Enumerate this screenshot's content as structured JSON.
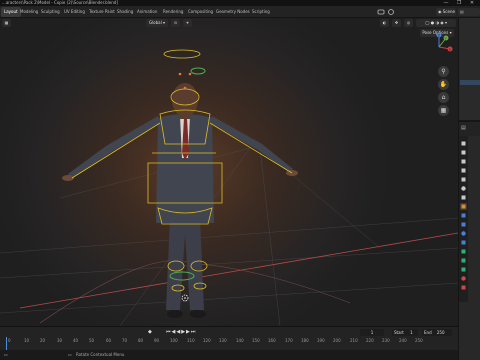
{
  "window": {
    "title": "...aracters\\Pack 2\\Model - Copie (2)\\Source\\Blender.blend]",
    "buttons": [
      "—",
      "❐",
      "✕"
    ]
  },
  "menubar": {
    "workspaces": [
      "Layout",
      "Modeling",
      "Sculpting",
      "UV Editing",
      "Texture Paint",
      "Shading",
      "Animation",
      "Rendering",
      "Compositing",
      "Geometry Nodes",
      "Scripting"
    ],
    "active_workspace": "Layout",
    "scene_label": "Scene"
  },
  "viewport": {
    "mode_label": "Global",
    "pose_options": "Pose Options",
    "axis_x": "X",
    "axis_y": "Y",
    "axis_z": "Z",
    "colors": {
      "bones": "#e0c020",
      "accent_ring": "#4caf50",
      "floor_line": "#b84a4a"
    }
  },
  "timeline": {
    "ruler_ticks": [
      "0",
      "10",
      "20",
      "30",
      "40",
      "50",
      "60",
      "70",
      "80",
      "90",
      "100",
      "110",
      "120",
      "130",
      "140",
      "150",
      "160",
      "170",
      "180",
      "190",
      "200",
      "210",
      "220",
      "230",
      "240",
      "250"
    ],
    "current_frame": "1",
    "start_label": "Start",
    "start_value": "1",
    "end_label": "End",
    "end_value": "250"
  },
  "statusbar": {
    "hint": "Rotate Contextual Menu"
  },
  "properties": {
    "tab_icons": [
      "tool-icon",
      "render-icon",
      "output-icon",
      "view-layer-icon",
      "scene-icon",
      "world-icon",
      "collection-icon",
      "object-icon",
      "modifier-icon",
      "particles-icon",
      "physics-icon",
      "constraint-icon",
      "data-icon",
      "bone-icon",
      "bone-constraint-icon",
      "material-icon",
      "texture-icon"
    ],
    "tab_colors": [
      "#c9c9c9",
      "#c9c9c9",
      "#c9c9c9",
      "#c9c9c9",
      "#c9c9c9",
      "#c9c9c9",
      "#c9c9c9",
      "#e08a2a",
      "#4a7fd6",
      "#4a7fd6",
      "#4a7fd6",
      "#4a7fd6",
      "#2fb07a",
      "#2fb07a",
      "#2fb07a",
      "#c94a4a",
      "#c94a4a"
    ]
  }
}
